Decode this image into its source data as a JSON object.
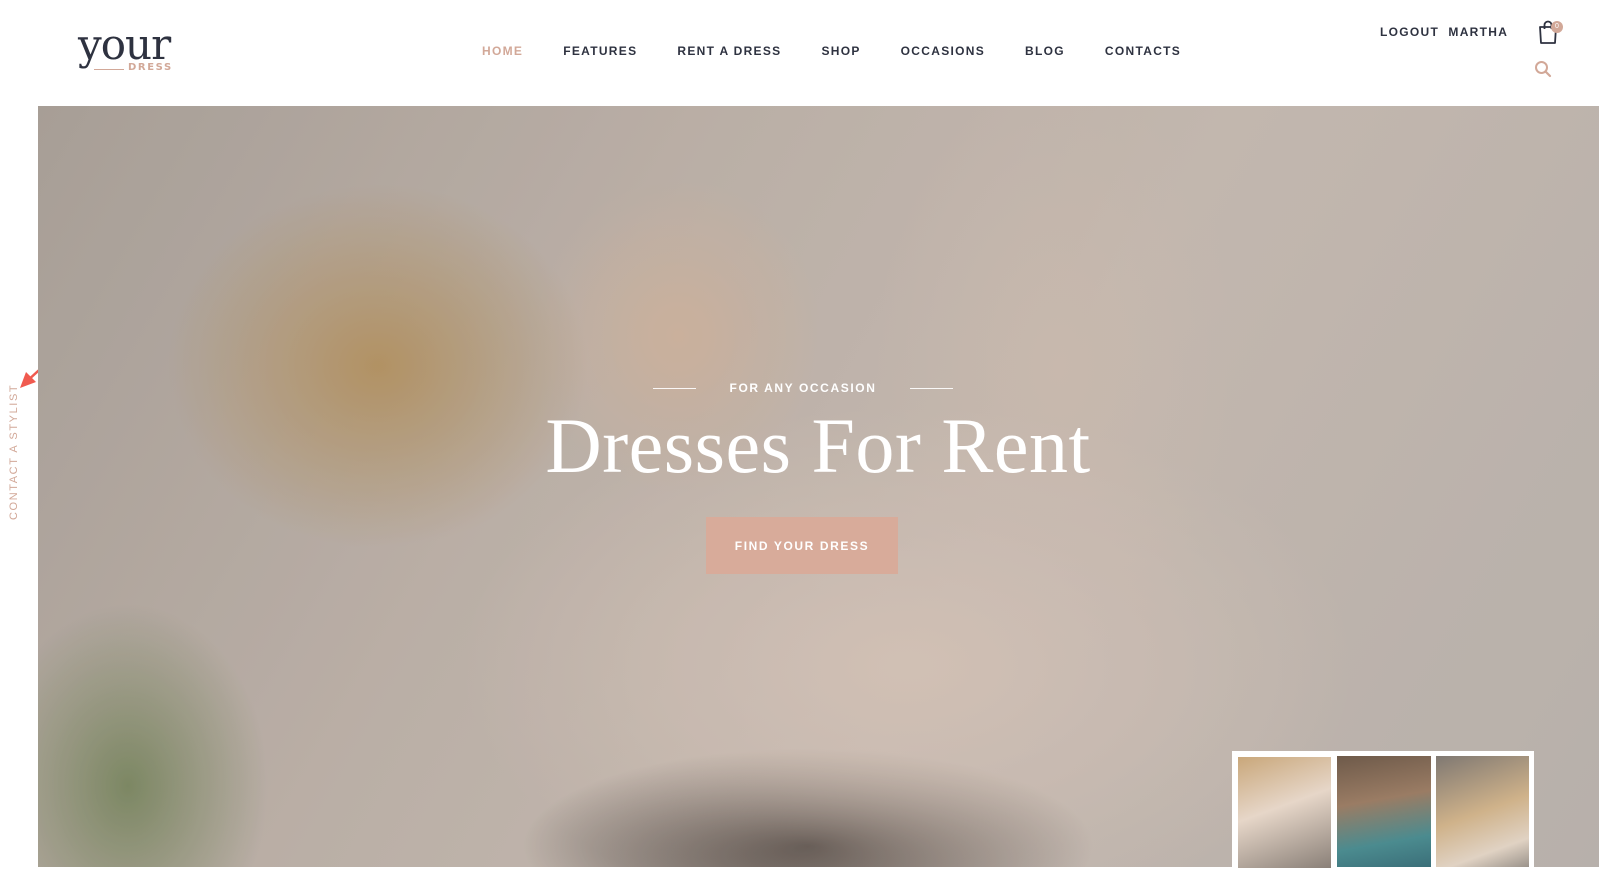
{
  "logo": {
    "main": "your",
    "sub": "DRESS"
  },
  "nav": {
    "items": [
      {
        "label": "HOME",
        "active": true
      },
      {
        "label": "FEATURES"
      },
      {
        "label": "RENT A DRESS"
      },
      {
        "label": "SHOP"
      },
      {
        "label": "OCCASIONS"
      },
      {
        "label": "BLOG"
      },
      {
        "label": "CONTACTS"
      }
    ]
  },
  "user": {
    "logout_label": "LOGOUT",
    "name": "MARTHA"
  },
  "cart": {
    "icon": "shopping-bag-icon",
    "count": "0"
  },
  "search": {
    "icon": "search-icon"
  },
  "side": {
    "contact_label": "CONTACT A STYLIST"
  },
  "hero": {
    "eyebrow": "FOR ANY OCCASION",
    "title": "Dresses For Rent",
    "cta_label": "FIND YOUR DRESS"
  },
  "thumbnails": {
    "count": 3,
    "active_index": 0
  },
  "colors": {
    "accent": "#d2a898",
    "text": "#2e3240",
    "cta": "#d8ab9a",
    "arrow": "#f05a4f"
  }
}
